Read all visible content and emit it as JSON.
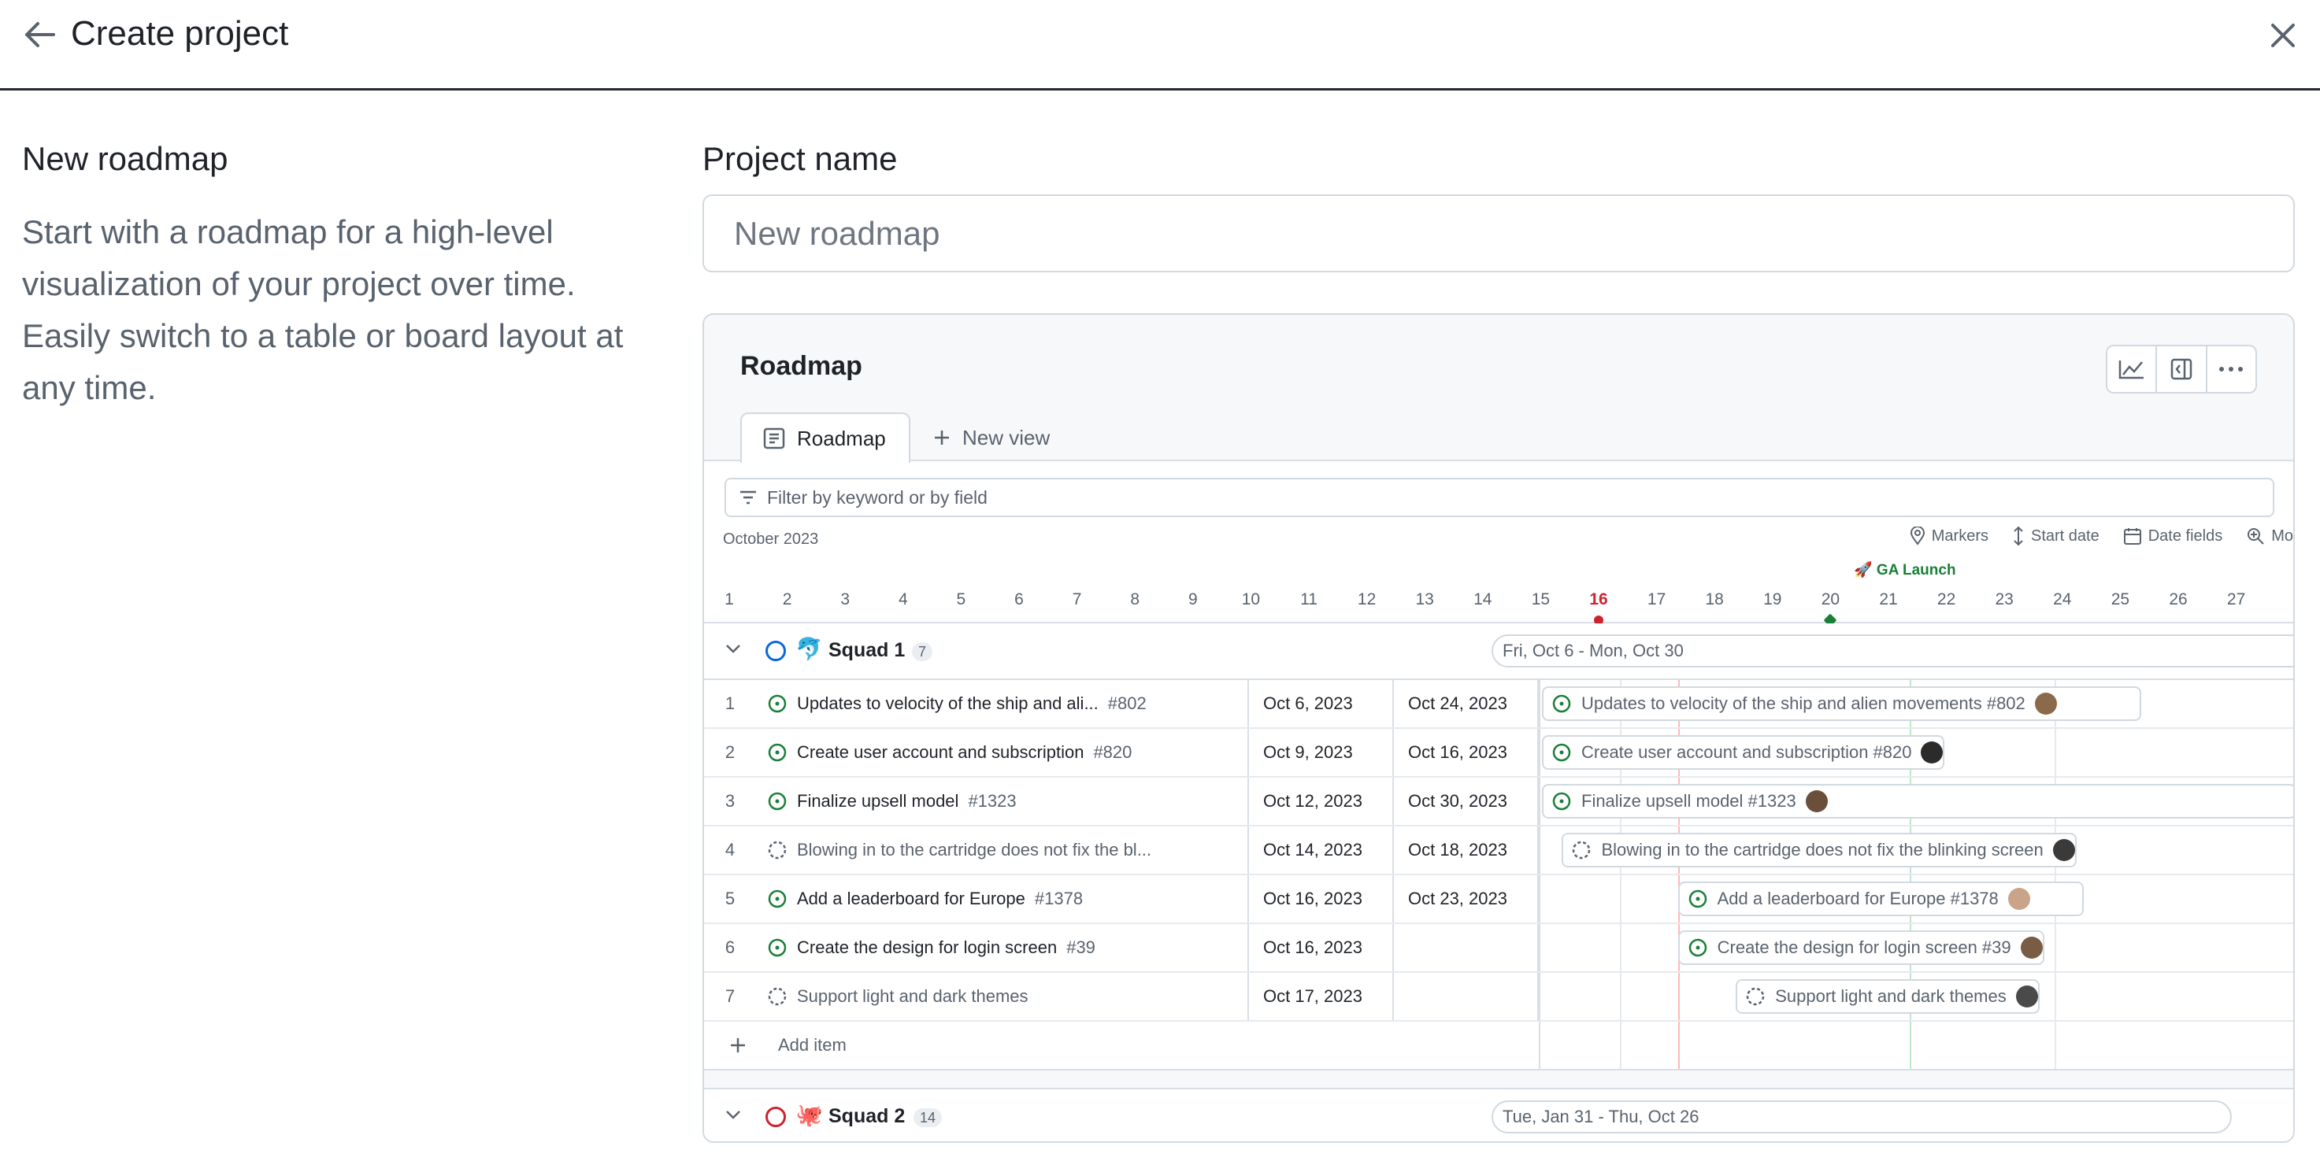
{
  "header": {
    "title": "Create project"
  },
  "template": {
    "title": "New roadmap",
    "description": "Start with a roadmap for a high-level visualization of your project over time. Easily switch to a table or board layout at any time."
  },
  "form": {
    "label": "Project name",
    "placeholder": "New roadmap"
  },
  "preview": {
    "title": "Roadmap",
    "tabs": [
      {
        "label": "Roadmap",
        "icon": "table-icon",
        "active": true
      },
      {
        "label": "New view",
        "icon": "plus-icon",
        "active": false
      }
    ],
    "filter_placeholder": "Filter by keyword or by field",
    "month": "October 2023",
    "controls": [
      {
        "label": "Markers",
        "icon": "location-icon"
      },
      {
        "label": "Start date",
        "icon": "arrows-vertical-icon"
      },
      {
        "label": "Date fields",
        "icon": "calendar-icon"
      },
      {
        "label": "Mo",
        "icon": "zoom-icon"
      }
    ],
    "marker": "🚀 GA Launch",
    "days": [
      "1",
      "2",
      "3",
      "4",
      "5",
      "6",
      "7",
      "8",
      "9",
      "10",
      "11",
      "12",
      "13",
      "14",
      "15",
      "16",
      "17",
      "18",
      "19",
      "20",
      "21",
      "22",
      "23",
      "24",
      "25",
      "26",
      "27"
    ],
    "today": "16",
    "groups": [
      {
        "name": "Squad 1",
        "emoji": "🐬",
        "count": "7",
        "range": "Fri, Oct 6 - Mon, Oct 30",
        "status_color": "#0969da",
        "items": [
          {
            "num": "1",
            "title": "Updates to velocity of the ship and ali...",
            "issue": "#802",
            "start": "Oct 6, 2023",
            "end": "Oct 24, 2023",
            "bar": "Updates to velocity of the ship and alien movements #802",
            "state": "open"
          },
          {
            "num": "2",
            "title": "Create user account and subscription",
            "issue": "#820",
            "start": "Oct 9, 2023",
            "end": "Oct 16, 2023",
            "bar": "Create user account and subscription #820",
            "state": "open"
          },
          {
            "num": "3",
            "title": "Finalize upsell model",
            "issue": "#1323",
            "start": "Oct 12, 2023",
            "end": "Oct 30, 2023",
            "bar": "Finalize upsell model #1323",
            "state": "open"
          },
          {
            "num": "4",
            "title": "Blowing in to the cartridge does not fix the bl...",
            "issue": "",
            "start": "Oct 14, 2023",
            "end": "Oct 18, 2023",
            "bar": "Blowing in to the cartridge does not fix the blinking screen",
            "state": "draft"
          },
          {
            "num": "5",
            "title": "Add a leaderboard for Europe",
            "issue": "#1378",
            "start": "Oct 16, 2023",
            "end": "Oct 23, 2023",
            "bar": "Add a leaderboard for Europe #1378",
            "state": "open"
          },
          {
            "num": "6",
            "title": "Create the design for login screen",
            "issue": "#39",
            "start": "Oct 16, 2023",
            "end": "",
            "bar": "Create the design for login screen #39",
            "state": "open"
          },
          {
            "num": "7",
            "title": "Support light and dark themes",
            "issue": "",
            "start": "Oct 17, 2023",
            "end": "",
            "bar": "Support light and dark themes",
            "state": "draft"
          }
        ],
        "add_item": "Add item"
      },
      {
        "name": "Squad 2",
        "emoji": "🐙",
        "count": "14",
        "range": "Tue, Jan 31 - Thu, Oct 26",
        "status_color": "#cf222e"
      }
    ]
  }
}
